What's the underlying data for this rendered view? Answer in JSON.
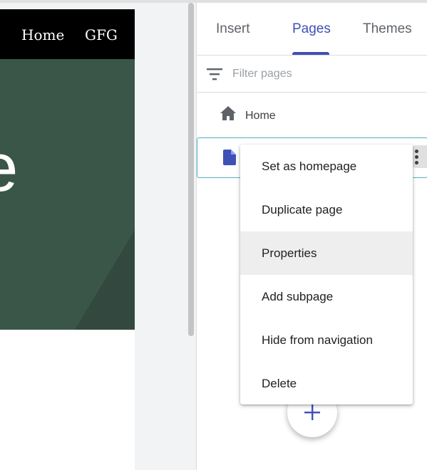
{
  "preview": {
    "nav_links": [
      "Home",
      "GFG"
    ],
    "hero_text_fragment": "e",
    "colors": {
      "nav_bg": "#000000",
      "hero_bg": "#3a5649"
    }
  },
  "panel": {
    "tabs": [
      {
        "label": "Insert",
        "active": false
      },
      {
        "label": "Pages",
        "active": true
      },
      {
        "label": "Themes",
        "active": false
      }
    ],
    "filter": {
      "placeholder": "Filter pages",
      "value": "",
      "icon": "filter-icon"
    },
    "pages": [
      {
        "label": "Home",
        "icon": "home-icon"
      },
      {
        "label": "",
        "icon": "document-icon",
        "selected": true
      }
    ],
    "accent_color": "#3f51b5"
  },
  "context_menu": {
    "items": [
      {
        "label": "Set as homepage"
      },
      {
        "label": "Duplicate page"
      },
      {
        "label": "Properties",
        "hovered": true
      },
      {
        "label": "Add subpage"
      },
      {
        "label": "Hide from navigation"
      },
      {
        "label": "Delete"
      }
    ]
  },
  "fab": {
    "icon": "plus-icon"
  }
}
